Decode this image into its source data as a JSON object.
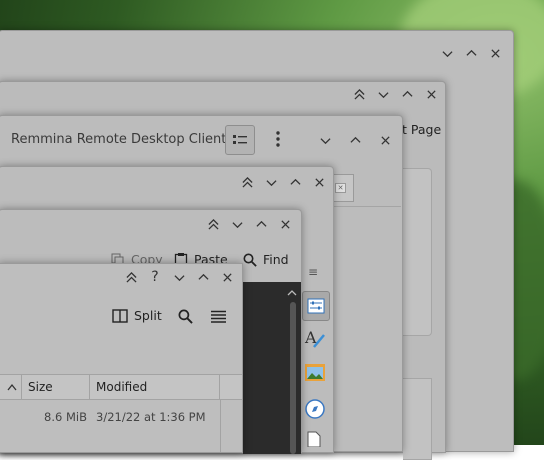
{
  "windows": {
    "back": {
      "controls": [
        "minimize",
        "maximize",
        "close"
      ]
    },
    "browser": {
      "controls": [
        "keep-above",
        "minimize",
        "maximize",
        "close"
      ],
      "tab_text": "t Page"
    },
    "remmina": {
      "title": "Remmina Remote Desktop Client",
      "controls": [
        "minimize",
        "maximize",
        "close"
      ]
    },
    "w4": {
      "controls": [
        "keep-above",
        "minimize",
        "maximize",
        "close"
      ]
    },
    "editor": {
      "controls": [
        "keep-above",
        "minimize",
        "maximize",
        "close"
      ],
      "toolbar": {
        "copy": "Copy",
        "paste": "Paste",
        "find": "Find"
      }
    },
    "dolphin": {
      "controls": [
        "keep-above",
        "help",
        "minimize",
        "maximize",
        "close"
      ],
      "toolbar": {
        "split": "Split"
      },
      "table": {
        "headers": {
          "size": "Size",
          "modified": "Modified"
        },
        "rows": [
          {
            "size": "8.6 MiB",
            "modified": "3/21/22 at 1:36 PM"
          }
        ]
      }
    }
  }
}
